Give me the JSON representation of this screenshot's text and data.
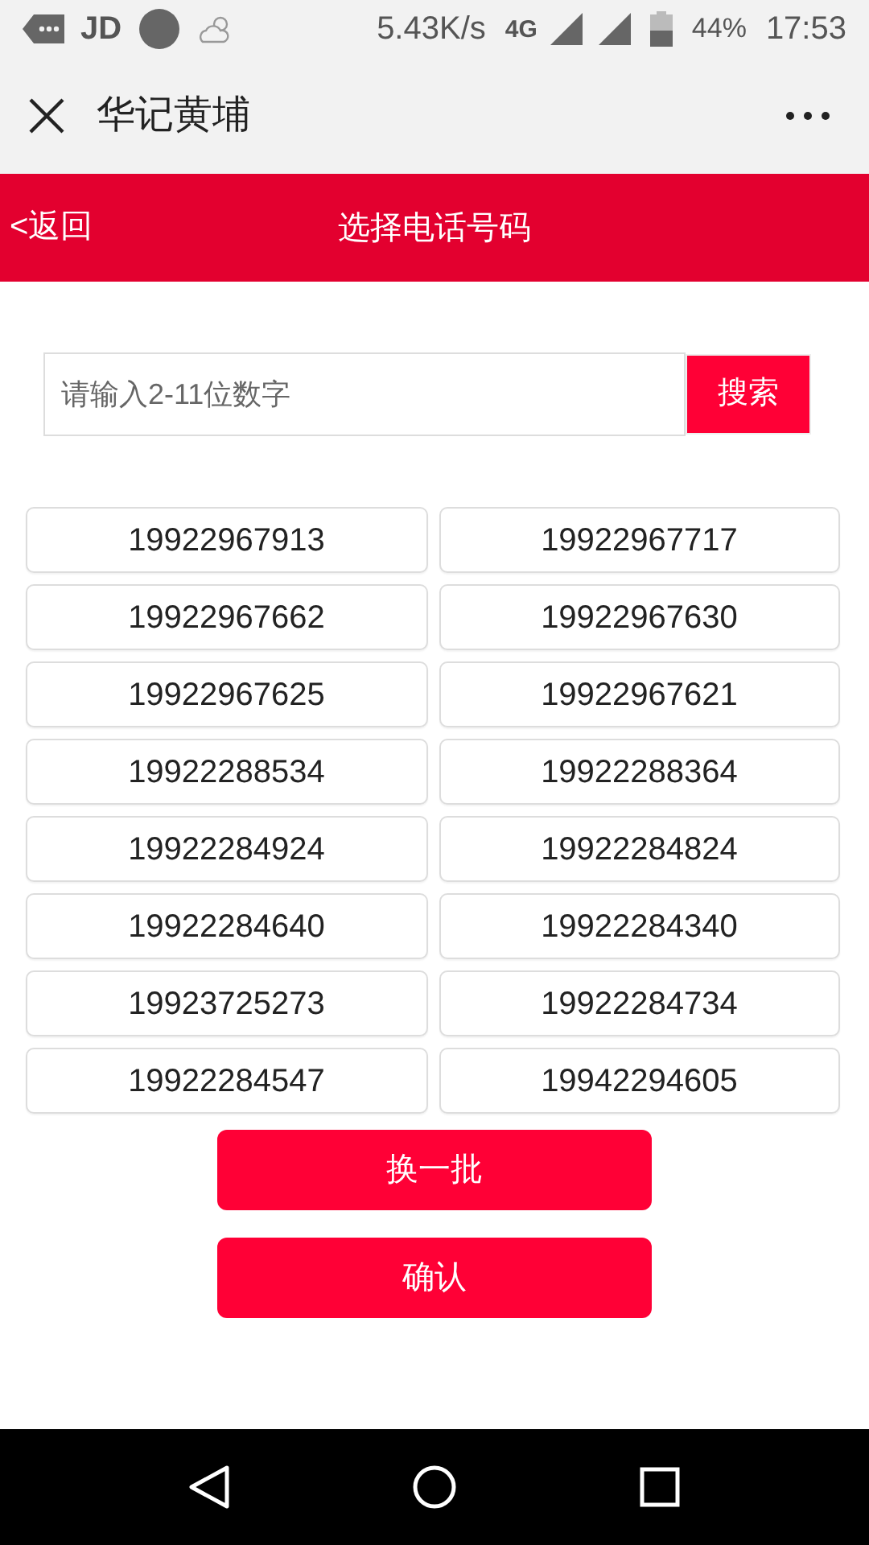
{
  "status_bar": {
    "carrier": "JD",
    "speed": "5.43K/s",
    "network": "4G",
    "battery": "44%",
    "time": "17:53"
  },
  "app_bar": {
    "title": "华记黄埔"
  },
  "header": {
    "back": "<返回",
    "title": "选择电话号码"
  },
  "search": {
    "placeholder": "请输入2-11位数字",
    "button": "搜索"
  },
  "numbers": [
    "19922967913",
    "19922967717",
    "19922967662",
    "19922967630",
    "19922967625",
    "19922967621",
    "19922288534",
    "19922288364",
    "19922284924",
    "19922284824",
    "19922284640",
    "19922284340",
    "19923725273",
    "19922284734",
    "19922284547",
    "19942294605"
  ],
  "actions": [
    "换一批",
    "确认"
  ]
}
